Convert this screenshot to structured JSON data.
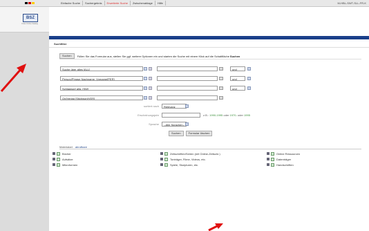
{
  "topbar": {
    "tabs": [
      "Einfache Suche",
      "Suchergebnis",
      "Erweiterte Suche",
      "Zwischenablage",
      "Hilfe"
    ],
    "active_tab": "Erweiterte Suche",
    "user_info": "M-HBL-SWT-SLL-FR-K"
  },
  "logo": {
    "text": "BSZ",
    "subtitle": "Union Online Katalog"
  },
  "section_title": "Suchfilter",
  "instructions": {
    "button": "Suchen",
    "text": "Füllen Sie das Formular aus, stellen Sie ggf. weitere Optionen ein und starten die Suche mit einem Klick auf die Schaltfläche",
    "bold": "Suchen"
  },
  "search_rows": [
    {
      "field": "Suche über alles [ALL]",
      "operator": "und"
    },
    {
      "field": "Person/Phrase Nachname, Vorname[PER]",
      "operator": "und"
    },
    {
      "field": "Schlagwort allg. [SW]",
      "operator": "und"
    },
    {
      "field": "Ort/Verlag [Stichwort/VER]",
      "operator": ""
    }
  ],
  "sort": {
    "label": "sortiert nach",
    "value": "Relevanz"
  },
  "year": {
    "label": "Erscheinungsjahr",
    "hint_prefix": "z.B.:",
    "hint_values": [
      "1990-1995",
      "1970-",
      "1995"
    ],
    "hint_sep": [
      "oder",
      "oder"
    ]
  },
  "language": {
    "label": "Sprache",
    "value": "--Alle Sprachen--"
  },
  "buttons": {
    "search": "Suchen",
    "clear": "Formular löschen"
  },
  "material": {
    "title": "Materialart",
    "link": "abrufbare",
    "items": [
      [
        "Bücher",
        "Zeitschriften/Serien (mit Online-Zeitschr.)",
        "Online Ressourcen"
      ],
      [
        "Aufsätze",
        "Tonträger, Filme, Videos, etc.",
        "Datenträger"
      ],
      [
        "Mikroformen",
        "Spiele, Skulpturen, etc.",
        "Handschriften"
      ]
    ]
  },
  "colors": {
    "accent": "#1a3f8a",
    "sidebar": "#dcdcdc",
    "arrow": "#e01010"
  }
}
